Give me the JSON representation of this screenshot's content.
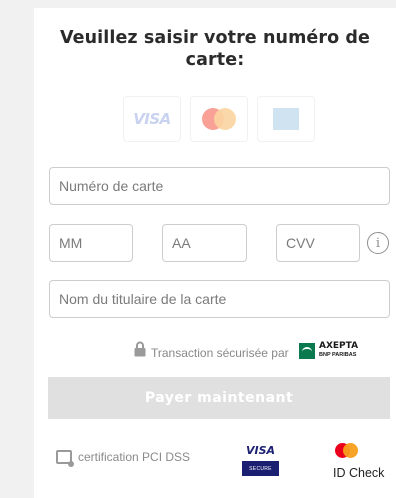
{
  "form": {
    "title": "Veuillez saisir votre numéro de carte:",
    "card_logos": {
      "visa": "VISA",
      "mastercard_colors": {
        "left": "#f9a196",
        "right": "#fbd4a0"
      },
      "amex_color": "#cfe3f1"
    },
    "card_number_placeholder": "Numéro de carte",
    "month_placeholder": "MM",
    "year_placeholder": "AA",
    "cvv_placeholder": "CVV",
    "info_symbol": "i",
    "cardholder_placeholder": "Nom du titulaire de la carte",
    "secure_text": "Transaction sécurisée par",
    "provider_name": "AXEPTA",
    "provider_sub": "BNP PARIBAS",
    "pay_label": "Payer maintenant"
  },
  "footer": {
    "pci_text": "certification PCI DSS",
    "visa_secure_top": "VISA",
    "visa_secure_bottom": "SECURE",
    "id_check_text": "ID Check",
    "mastercard_colors": {
      "left": "#eb001b",
      "right": "#f79e1b"
    }
  }
}
